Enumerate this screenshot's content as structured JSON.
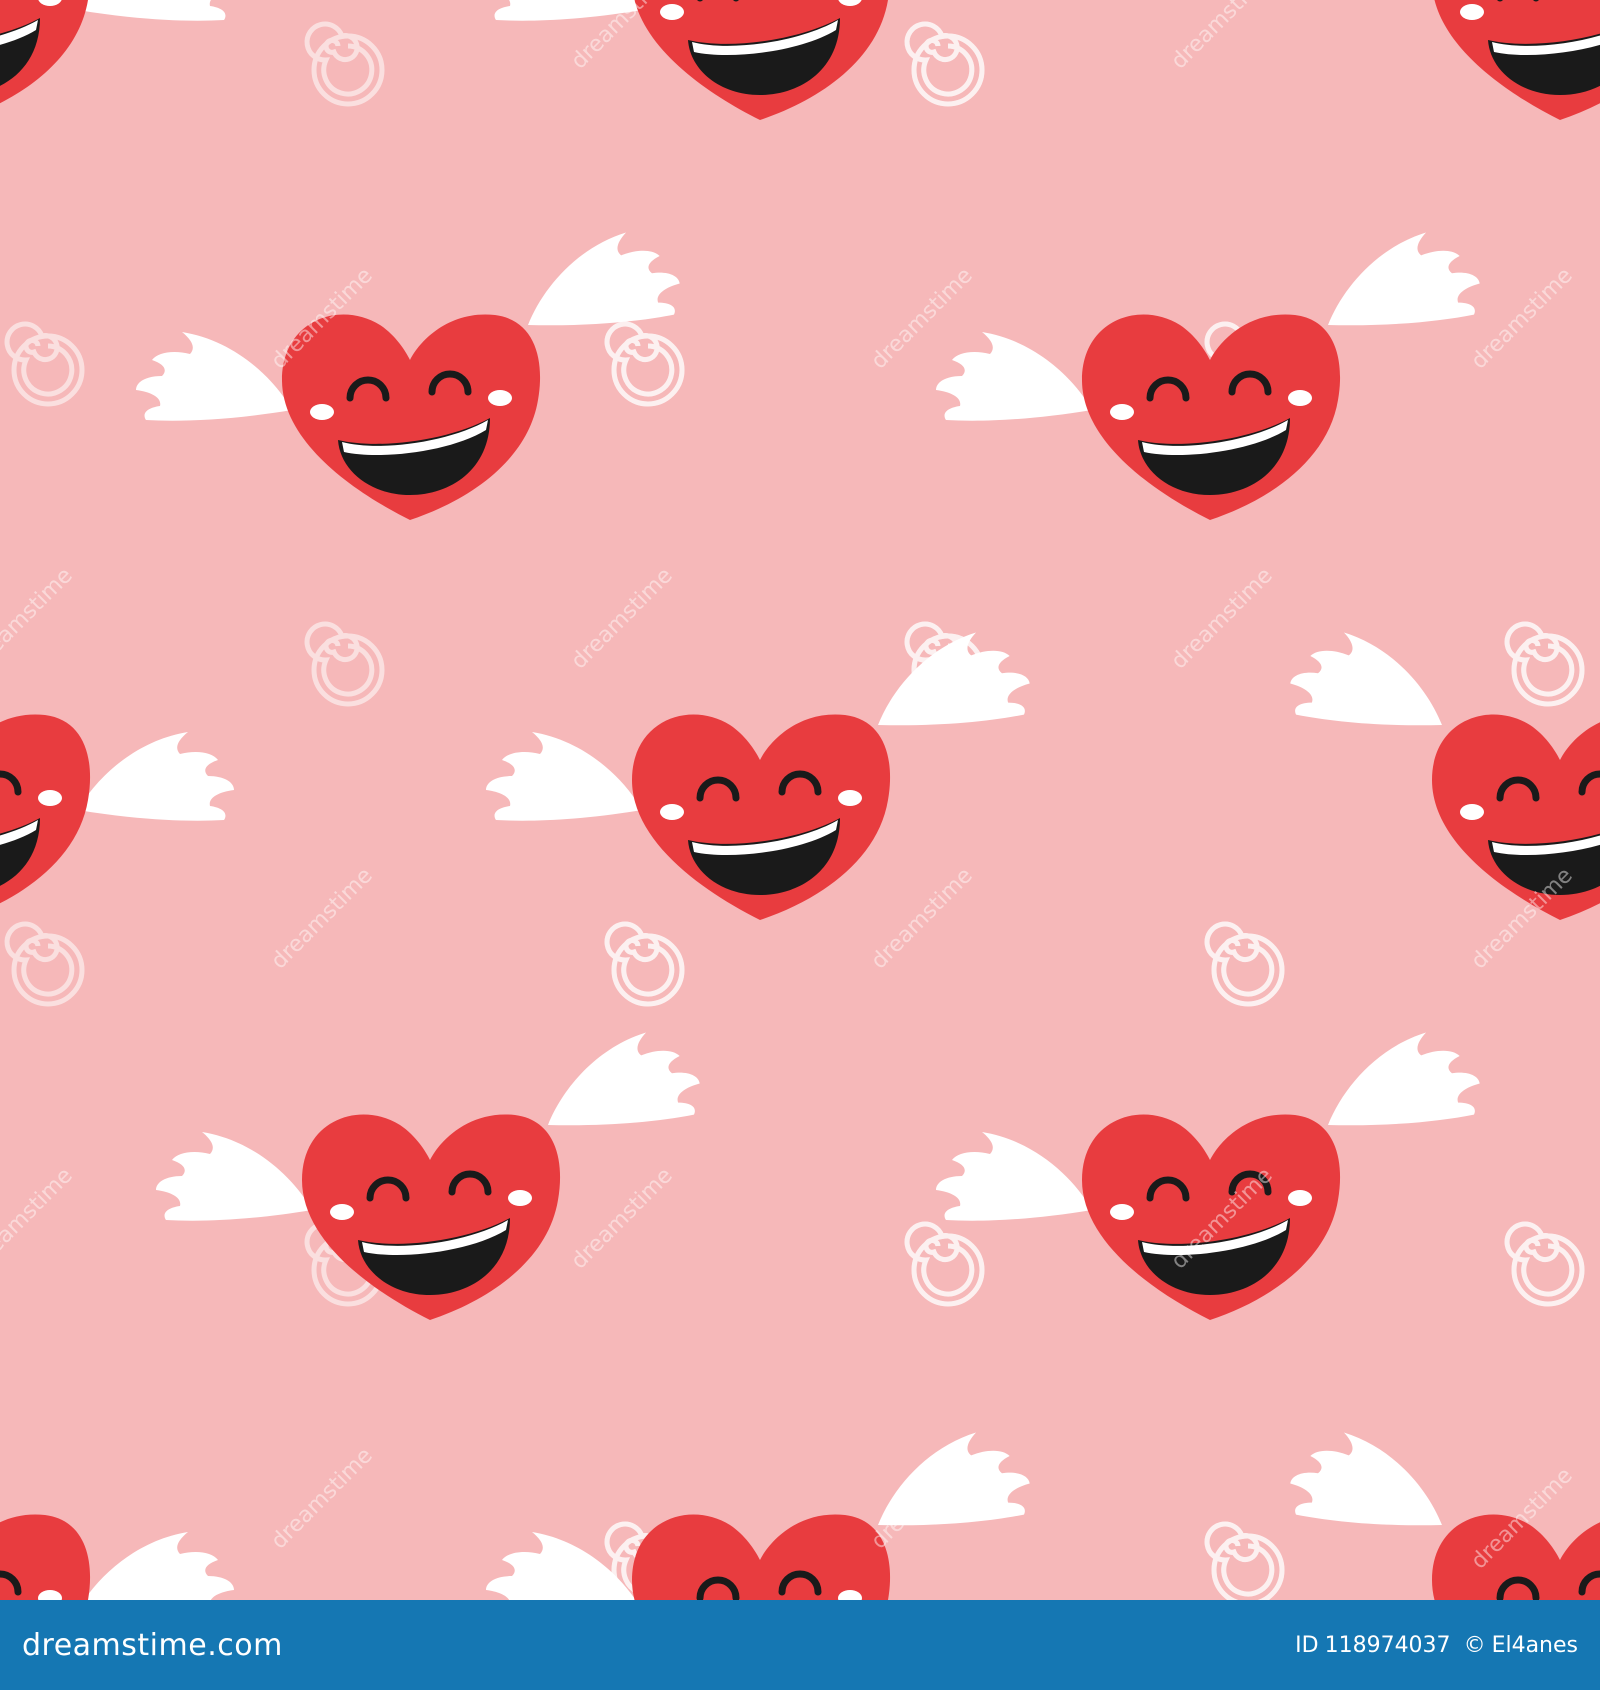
{
  "colors": {
    "background": "#f6b8b9",
    "heart": "#e83c3f",
    "heart_shadow": "#d62f33",
    "mouth": "#1a1a1a",
    "teeth": "#ffffff",
    "wing": "#ffffff",
    "blush": "#ffffff",
    "watermark": "#ffffff",
    "bar": "#1577b3"
  },
  "pattern": {
    "subject": "smiling-winged-heart-icon",
    "watermark_icon": "spiral-icon",
    "watermark_text": "dreamstime"
  },
  "footer": {
    "brand": "dreamstime.com",
    "id_label": "ID",
    "id_value": "118974037",
    "copyright_symbol": "©",
    "author": "El4anes"
  }
}
